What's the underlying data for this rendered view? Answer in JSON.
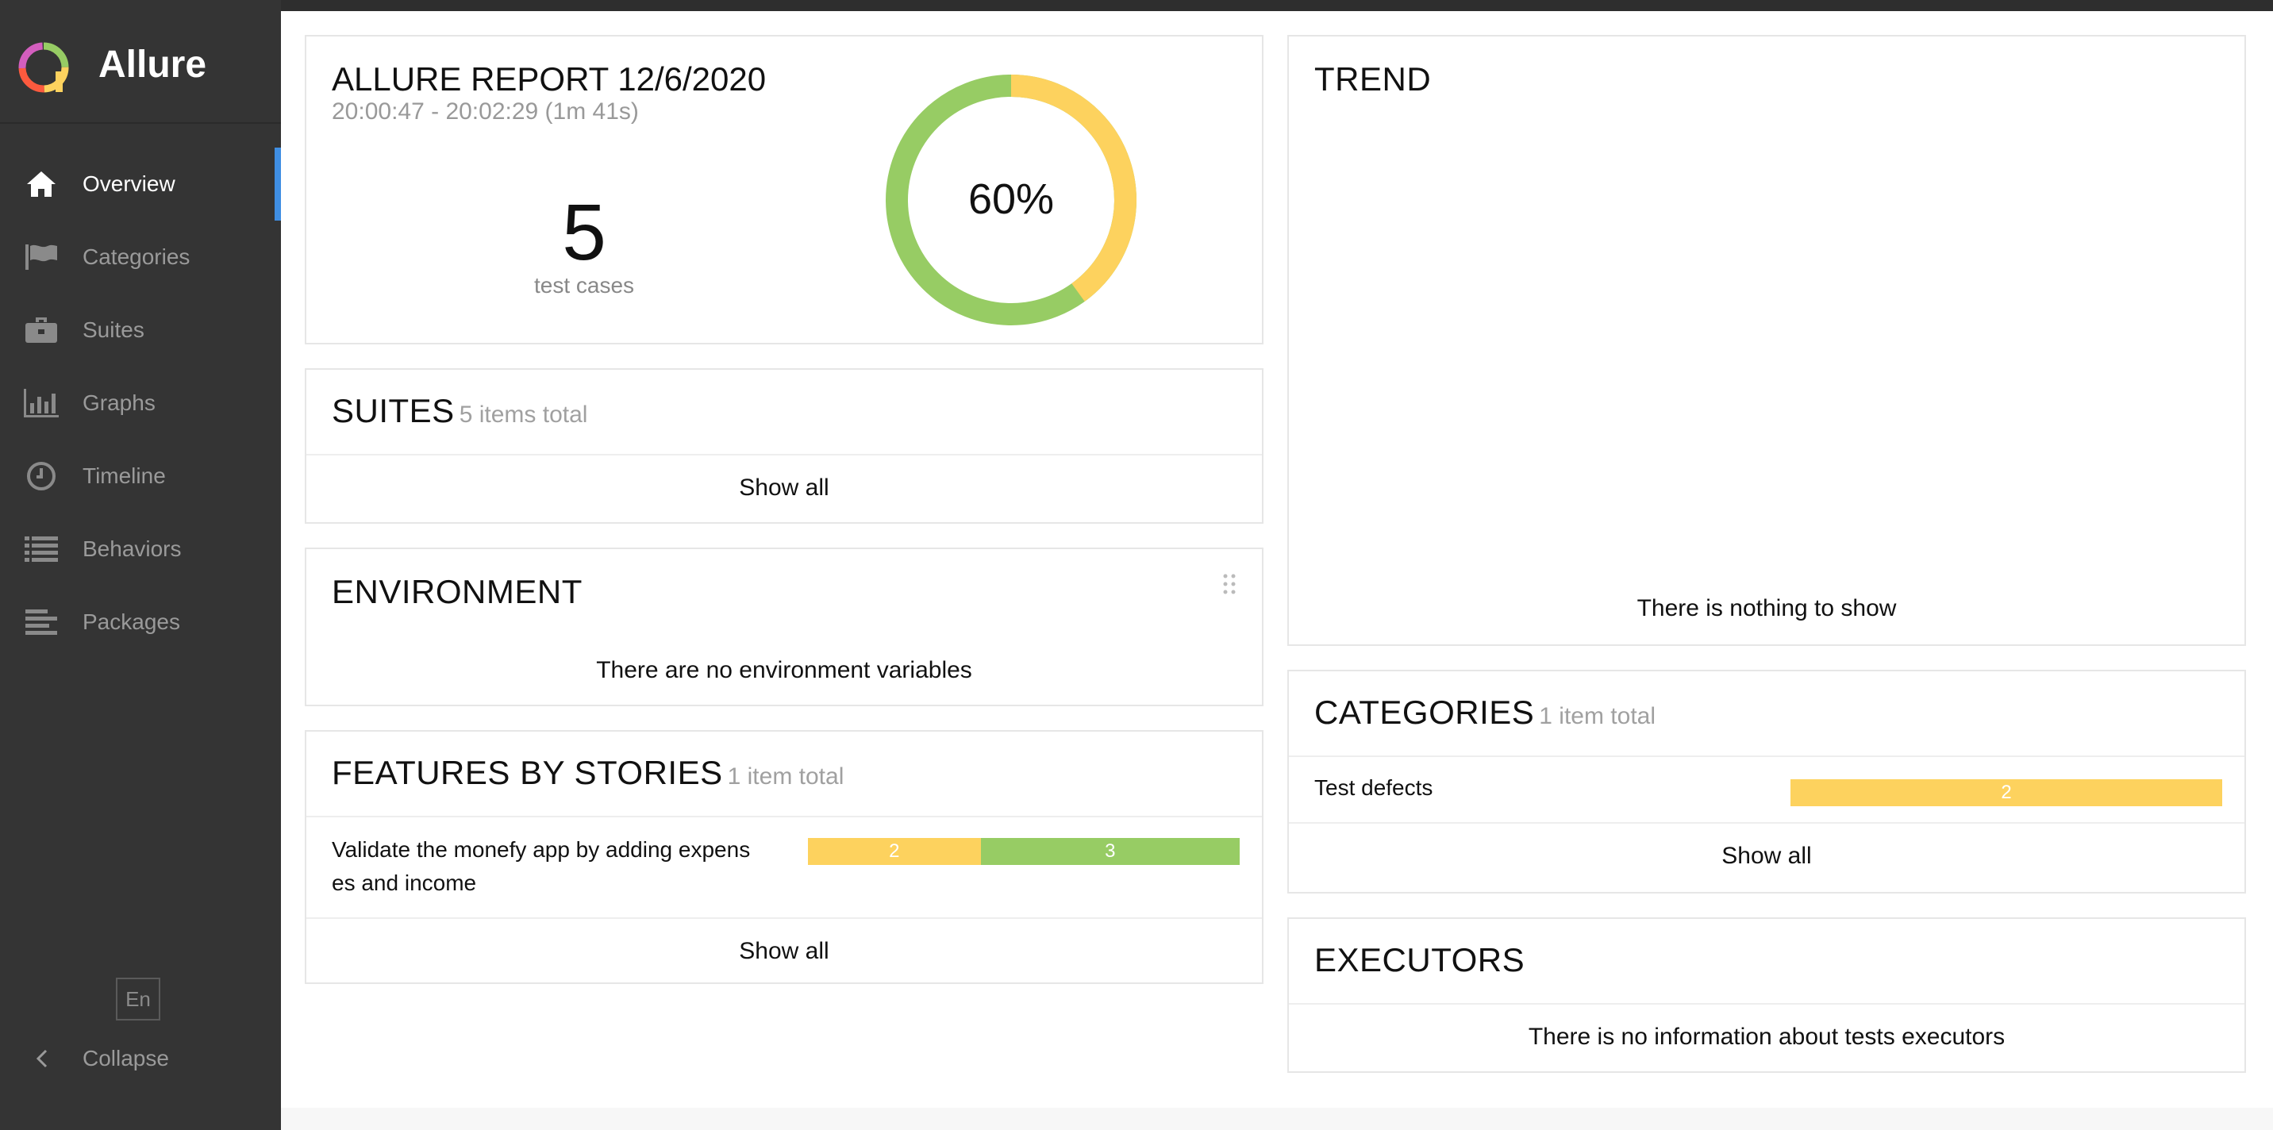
{
  "app": {
    "name": "Allure"
  },
  "colors": {
    "accent": "#3f8ee2",
    "broken": "#fdd25e",
    "passed": "#97cc64",
    "sidebar": "#343434"
  },
  "sidebar": {
    "items": [
      {
        "label": "Overview",
        "icon": "home-icon",
        "active": true
      },
      {
        "label": "Categories",
        "icon": "flag-icon",
        "active": false
      },
      {
        "label": "Suites",
        "icon": "briefcase-icon",
        "active": false
      },
      {
        "label": "Graphs",
        "icon": "bar-chart-icon",
        "active": false
      },
      {
        "label": "Timeline",
        "icon": "clock-icon",
        "active": false
      },
      {
        "label": "Behaviors",
        "icon": "list-icon",
        "active": false
      },
      {
        "label": "Packages",
        "icon": "align-left-icon",
        "active": false
      }
    ],
    "language": "En",
    "collapse_label": "Collapse"
  },
  "summary": {
    "title": "ALLURE REPORT 12/6/2020",
    "time": "20:00:47 - 20:02:29 (1m 41s)",
    "count": "5",
    "count_label": "test cases",
    "percent": "60%",
    "donut": {
      "passed": 3,
      "broken": 2
    }
  },
  "suites": {
    "title": "SUITES",
    "count": "5 items total",
    "show_all": "Show all"
  },
  "environment": {
    "title": "ENVIRONMENT",
    "empty": "There are no environment variables"
  },
  "features": {
    "title": "FEATURES BY STORIES",
    "count": "1 item total",
    "rows": [
      {
        "label_line1": "Validate the monefy app by adding expens",
        "label_line2": "es and income",
        "broken": "2",
        "passed": "3"
      }
    ],
    "show_all": "Show all"
  },
  "trend": {
    "title": "TREND",
    "empty": "There is nothing to show"
  },
  "categories": {
    "title": "CATEGORIES",
    "count": "1 item total",
    "rows": [
      {
        "label": "Test defects",
        "value": "2"
      }
    ],
    "show_all": "Show all"
  },
  "executors": {
    "title": "EXECUTORS",
    "empty": "There is no information about tests executors"
  }
}
